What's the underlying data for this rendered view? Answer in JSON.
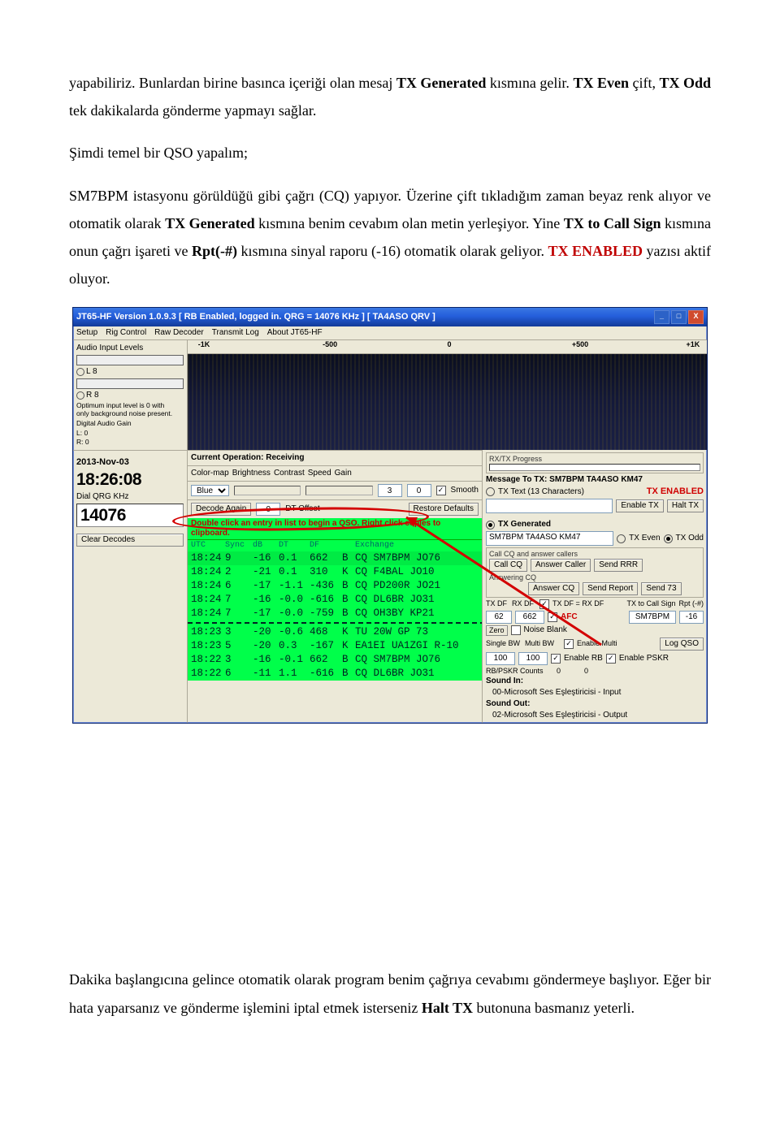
{
  "para1_a": "yapabiliriz. Bunlardan birine basınca içeriği olan mesaj ",
  "para1_b_bold": "TX Generated",
  "para1_c": " kısmına gelir. ",
  "para1_d_bold": "TX Even",
  "para1_e": " çift, ",
  "para1_f_bold": "TX Odd",
  "para1_g": " tek dakikalarda gönderme yapmayı sağlar.",
  "para2": "Şimdi temel bir QSO yapalım;",
  "para3_a": "SM7BPM istasyonu görüldüğü gibi çağrı (CQ) yapıyor. Üzerine çift tıkladığım zaman beyaz renk alıyor ve otomatik olarak ",
  "para3_b_bold": "TX Generated",
  "para3_c": " kısmına benim cevabım olan metin yerleşiyor. Yine ",
  "para3_d_bold": "TX to Call Sign",
  "para3_e": " kısmına onun çağrı işareti ve ",
  "para3_f_bold": "Rpt(-#)",
  "para3_g": " kısmına sinyal raporu (-16) otomatik olarak geliyor.",
  "para3_h": " ",
  "para3_i_red": "TX ENABLED",
  "para3_j": " yazısı aktif oluyor.",
  "para4_a": "Dakika başlangıcına gelince otomatik olarak program benim çağrıya cevabımı göndermeye başlıyor. Eğer bir hata yaparsanız ve gönderme işlemini iptal etmek isterseniz ",
  "para4_b_bold": "Halt TX",
  "para4_c": " butonuna basmanız yeterli.",
  "app": {
    "title": "JT65-HF Version 1.0.9.3  [ RB Enabled, logged in.  QRG = 14076 KHz ] [ TA4ASO QRV ]",
    "menu": [
      "Setup",
      "Rig Control",
      "Raw Decoder",
      "Transmit Log",
      "About JT65-HF"
    ],
    "ruler": [
      "-1K",
      "-500",
      "0",
      "+500",
      "+1K"
    ],
    "left": {
      "audio_label": "Audio Input Levels",
      "l_val": "L 8",
      "r_val": "R 8",
      "opt_note": "Optimum input level is 0 with\nonly background noise present.",
      "dag": "Digital Audio Gain",
      "lgain": "L: 0",
      "rgain": "R: 0",
      "date": "2013-Nov-03",
      "time": "18:26:08",
      "dial_lbl": "Dial QRG KHz",
      "dial": "14076"
    },
    "toolbar": {
      "curop": "Current Operation: Receiving",
      "colormap": "Color-map",
      "brightness": "Brightness",
      "contrast": "Contrast",
      "speed": "Speed",
      "gain": "Gain",
      "blue": "Blue",
      "three": "3",
      "zero": "0",
      "smooth": "Smooth"
    },
    "decbar": {
      "clear": "Clear Decodes",
      "again": "Decode Again",
      "dt": "0",
      "dtoff": "DT Offset",
      "restore": "Restore Defaults"
    },
    "hint": "Double click an entry in list to begin a QSO.  Right click copies to clipboard.",
    "cols": {
      "utc": "UTC",
      "sync": "Sync",
      "db": "dB",
      "dt": "DT",
      "df": "DF",
      "ex": "Exchange"
    },
    "decodes": [
      {
        "utc": "18:24",
        "sync": "9",
        "db": "-16",
        "dt": "0.1",
        "df": "662",
        "m": "B",
        "msg": "CQ SM7BPM JO76",
        "hl": true
      },
      {
        "utc": "18:24",
        "sync": "2",
        "db": "-21",
        "dt": "0.1",
        "df": "310",
        "m": "K",
        "msg": "CQ F4BAL JO10"
      },
      {
        "utc": "18:24",
        "sync": "6",
        "db": "-17",
        "dt": "-1.1",
        "df": "-436",
        "m": "B",
        "msg": "CQ PD200R JO21"
      },
      {
        "utc": "18:24",
        "sync": "7",
        "db": "-16",
        "dt": "-0.0",
        "df": "-616",
        "m": "B",
        "msg": "CQ DL6BR JO31"
      },
      {
        "utc": "18:24",
        "sync": "7",
        "db": "-17",
        "dt": "-0.0",
        "df": "-759",
        "m": "B",
        "msg": "CQ OH3BY KP21"
      }
    ],
    "decodes2": [
      {
        "utc": "18:23",
        "sync": "3",
        "db": "-20",
        "dt": "-0.6",
        "df": "468",
        "m": "K",
        "msg": "TU 20W GP 73"
      },
      {
        "utc": "18:23",
        "sync": "5",
        "db": "-20",
        "dt": "0.3",
        "df": "-167",
        "m": "K",
        "msg": "EA1EI UA1ZGI R-10"
      },
      {
        "utc": "18:22",
        "sync": "3",
        "db": "-16",
        "dt": "-0.1",
        "df": "662",
        "m": "B",
        "msg": "CQ SM7BPM JO76"
      },
      {
        "utc": "18:22",
        "sync": "6",
        "db": "-11",
        "dt": "1.1",
        "df": "-616",
        "m": "B",
        "msg": "CQ DL6BR JO31"
      }
    ],
    "right": {
      "progress": "RX/TX Progress",
      "msgto": "Message To TX: SM7BPM TA4ASO KM47",
      "txtext": "TX Text (13 Characters)",
      "txenabled": "TX ENABLED",
      "enabletx": "Enable TX",
      "halttx": "Halt TX",
      "txgen": "TX Generated",
      "genval": "SM7BPM TA4ASO KM47",
      "txeven": "TX Even",
      "txodd": "TX Odd",
      "callcqhdr": "Call CQ and answer callers",
      "callcq": "Call CQ",
      "anscaller": "Answer Caller",
      "sendrrr": "Send RRR",
      "answeringcq": "Answering CQ",
      "anscq": "Answer CQ",
      "sendrep": "Send Report",
      "send73": "Send 73",
      "txdf_lbl": "TX DF",
      "rxdf_lbl": "RX DF",
      "txdfrxdf": "TX DF = RX DF",
      "txtocall": "TX to Call Sign",
      "rpt": "Rpt (-#)",
      "txdf_v": "62",
      "rxdf_v": "662",
      "afc": "AFC",
      "zero": "Zero",
      "noiseblank": "Noise Blank",
      "singlebw": "Single BW",
      "multibw": "Multi BW",
      "enablemulti": "Enable Multi",
      "sbw": "100",
      "mbw": "100",
      "logqso": "Log QSO",
      "enablerb": "Enable RB",
      "enablepskr": "Enable PSKR",
      "rbcounts": "RB/PSKR Counts",
      "rb0a": "0",
      "rb0b": "0",
      "soundin_lbl": "Sound In:",
      "soundin": "00-Microsoft Ses Eşleştiricisi - Input",
      "soundout_lbl": "Sound Out:",
      "soundout": "02-Microsoft Ses Eşleştiricisi - Output",
      "callsign": "SM7BPM",
      "rptval": "-16"
    }
  }
}
